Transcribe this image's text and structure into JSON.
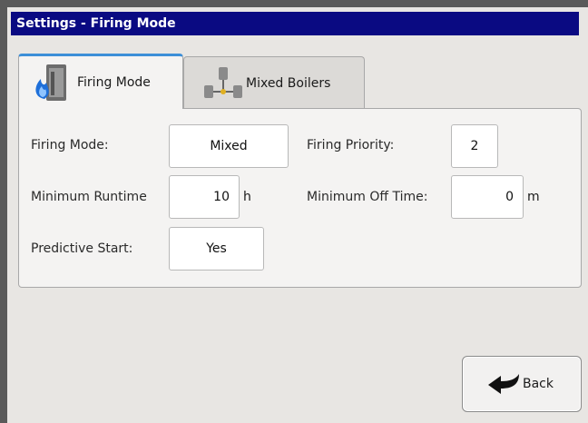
{
  "window": {
    "title": "Settings - Firing Mode"
  },
  "tabs": [
    {
      "label": "Firing Mode",
      "icon": "boiler-flame-icon",
      "active": true
    },
    {
      "label": "Mixed Boilers",
      "icon": "boiler-network-icon",
      "active": false
    }
  ],
  "fields": {
    "firing_mode": {
      "label": "Firing Mode:",
      "value": "Mixed"
    },
    "firing_priority": {
      "label": "Firing Priority:",
      "value": "2"
    },
    "minimum_runtime": {
      "label": "Minimum Runtime",
      "value": "10",
      "unit": "h"
    },
    "minimum_off_time": {
      "label": "Minimum Off Time:",
      "value": "0",
      "unit": "m"
    },
    "predictive_start": {
      "label": "Predictive Start:",
      "value": "Yes"
    }
  },
  "back_button": {
    "label": "Back",
    "icon": "back-arrow-icon"
  },
  "colors": {
    "titlebar": "#0a0a82",
    "tab_accent": "#3c8fd8"
  }
}
